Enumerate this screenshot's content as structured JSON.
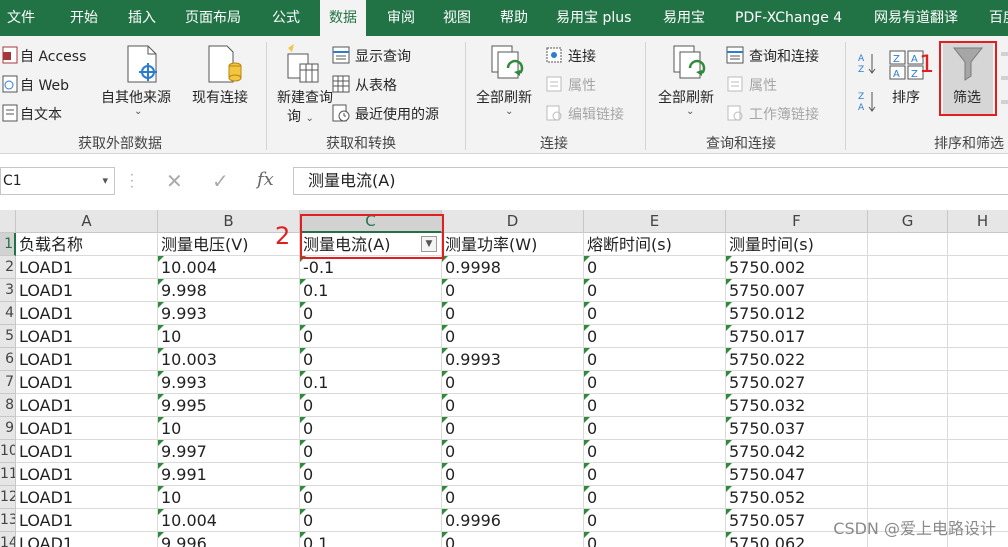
{
  "tabs": [
    "文件",
    "开始",
    "插入",
    "页面布局",
    "公式",
    "数据",
    "审阅",
    "视图",
    "帮助",
    "易用宝 plus",
    "易用宝",
    "PDF-XChange 4",
    "网易有道翻译",
    "百度"
  ],
  "active_tab": "数据",
  "ribbon": {
    "get_external": {
      "from_access": "自 Access",
      "from_web": "自 Web",
      "from_text": "自文本",
      "from_other": "自其他来源",
      "existing": "现有连接",
      "group_label": "获取外部数据"
    },
    "get_transform": {
      "new_query": "新建查询",
      "new_query_l2": "询",
      "show_queries": "显示查询",
      "from_table": "从表格",
      "recent_sources": "最近使用的源",
      "group_label": "获取和转换"
    },
    "connections": {
      "refresh_all": "全部刷新",
      "connections": "连接",
      "properties": "属性",
      "edit_links": "编辑链接",
      "group_label": "连接"
    },
    "queries_connections": {
      "refresh_all": "全部刷新",
      "queries_and_connections": "查询和连接",
      "properties": "属性",
      "workbook_links": "工作簿链接",
      "group_label": "查询和连接"
    },
    "sort_filter": {
      "sort": "排序",
      "filter": "筛选",
      "group_label": "排序和筛选"
    }
  },
  "annotations": {
    "one": "1",
    "two": "2"
  },
  "name_box": "C1",
  "formula_fx": "fx",
  "formula_value": "测量电流(A)",
  "columns": [
    "A",
    "B",
    "C",
    "D",
    "E",
    "F",
    "G",
    "H"
  ],
  "row_numbers": [
    "1",
    "2",
    "3",
    "4",
    "5",
    "6",
    "7",
    "8",
    "9",
    "10",
    "11",
    "12",
    "13",
    "14"
  ],
  "rows": [
    [
      "负载名称",
      "测量电压(V)",
      "测量电流(A)",
      "测量功率(W)",
      "熔断时间(s)",
      "测量时间(s)"
    ],
    [
      "LOAD1",
      "10.004",
      "-0.1",
      "0.9998",
      "0",
      "5750.002"
    ],
    [
      "LOAD1",
      "9.998",
      "0.1",
      "0",
      "0",
      "5750.007"
    ],
    [
      "LOAD1",
      "9.993",
      "0",
      "0",
      "0",
      "5750.012"
    ],
    [
      "LOAD1",
      "10",
      "0",
      "0",
      "0",
      "5750.017"
    ],
    [
      "LOAD1",
      "10.003",
      "0",
      "0.9993",
      "0",
      "5750.022"
    ],
    [
      "LOAD1",
      "9.993",
      "0.1",
      "0",
      "0",
      "5750.027"
    ],
    [
      "LOAD1",
      "9.995",
      "0",
      "0",
      "0",
      "5750.032"
    ],
    [
      "LOAD1",
      "10",
      "0",
      "0",
      "0",
      "5750.037"
    ],
    [
      "LOAD1",
      "9.997",
      "0",
      "0",
      "0",
      "5750.042"
    ],
    [
      "LOAD1",
      "9.991",
      "0",
      "0",
      "0",
      "5750.047"
    ],
    [
      "LOAD1",
      "10",
      "0",
      "0",
      "0",
      "5750.052"
    ],
    [
      "LOAD1",
      "10.004",
      "0",
      "0.9996",
      "0",
      "5750.057"
    ],
    [
      "LOAD1",
      "9.996",
      "0.1",
      "0",
      "0",
      "5750.062"
    ]
  ],
  "watermark": "CSDN @爱上电路设计",
  "colors": {
    "excel_green": "#217346",
    "annotation_red": "#e02020",
    "number_marker": "#2e8b3a"
  }
}
